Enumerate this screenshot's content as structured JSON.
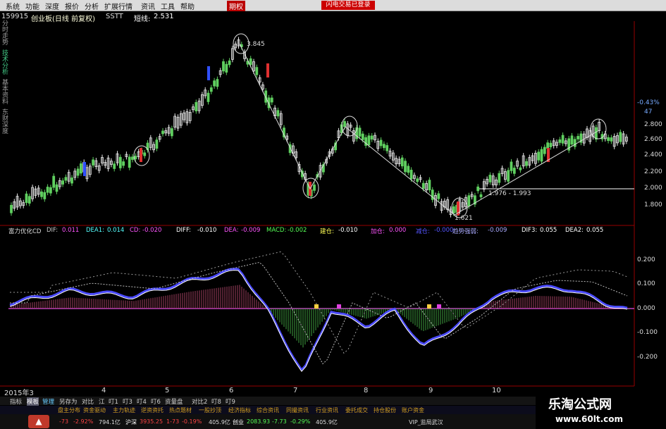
{
  "menu": {
    "items": [
      "系统",
      "功能",
      "深度",
      "报价",
      "分析",
      "扩展行情",
      "资讯",
      "工具",
      "帮助",
      "期权"
    ],
    "right_tab": "闪电交易已登录"
  },
  "info": {
    "code": "159915",
    "name": "创业板(日线 前复权)",
    "tag": "SSTT",
    "short_label": "短线:",
    "short_value": "2.531"
  },
  "sidetabs": [
    "分时走势",
    "技术分析",
    "基本资料",
    "东财深度"
  ],
  "price_labels": [
    "-0.43%",
    "47",
    "2.800",
    "2.600",
    "2.400",
    "2.200",
    "2.000",
    "1.800"
  ],
  "annotations": {
    "high": "3.845",
    "low": "1.621",
    "mid": "1.976 - 1.993"
  },
  "indicator": {
    "label": "富力优化CD",
    "items": [
      {
        "k": "DIF:",
        "v": "0.011",
        "c": "#ff55ff"
      },
      {
        "k": "DEA1:",
        "v": "0.014",
        "c": "#55ffff"
      },
      {
        "k": "CD:",
        "v": "-0.020",
        "c": "#ff55ff"
      },
      {
        "k": "DIFF:",
        "v": "-0.010",
        "c": "#ffffff"
      },
      {
        "k": "DEA:",
        "v": "-0.009",
        "c": "#ff55ff"
      },
      {
        "k": "MACD:",
        "v": "-0.002",
        "c": "#55ff55"
      },
      {
        "k": "建仓:",
        "v": "-0.010",
        "c": "#ffff55"
      },
      {
        "k": "加仓:",
        "v": "0.000",
        "c": "#ff55ff"
      },
      {
        "k": "减仓:",
        "v": "-0.000",
        "c": "#5555ff"
      },
      {
        "k": "趋势强弱:",
        "v": "-0.009",
        "c": "#aaaaff"
      },
      {
        "k": "DIF3:",
        "v": "0.055",
        "c": "#ffffff"
      },
      {
        "k": "DEA2:",
        "v": "0.055",
        "c": "#ffffff"
      }
    ]
  },
  "ind_axis": [
    "0.200",
    "0.100",
    "0.000",
    "-0.100",
    "-0.200"
  ],
  "xaxis": [
    "2015年3",
    "4",
    "5",
    "6",
    "7",
    "8",
    "9",
    "10"
  ],
  "toolbar": {
    "items": [
      "指标",
      "模板",
      "管理",
      "另存为",
      "对比",
      "江",
      "叮1",
      "叮3",
      "叮4",
      "叮6",
      "资量盘",
      "对比2",
      "叮8",
      "叮9"
    ],
    "row2": [
      "盘主分布",
      "资金驱动",
      "主力轨迹",
      "逆资资托",
      "热点题材",
      "一股抄顶",
      "经济指标",
      "综合资讯",
      "同撮资讯",
      "行业资讯",
      "委托成交",
      "持仓股份",
      "账户资金"
    ]
  },
  "taskbar": {
    "items": [
      "-73",
      "-2.92%",
      "794.1亿",
      "沪深",
      "3935.25",
      "1-73",
      "-0.19%",
      "405.9亿",
      "创业",
      "2083.93",
      "-7.73",
      "-0.29%",
      "405.9亿",
      "VIP_监局武汉"
    ]
  },
  "brand": {
    "name": "乐淘公式网",
    "url": "www.60lt.com"
  }
}
